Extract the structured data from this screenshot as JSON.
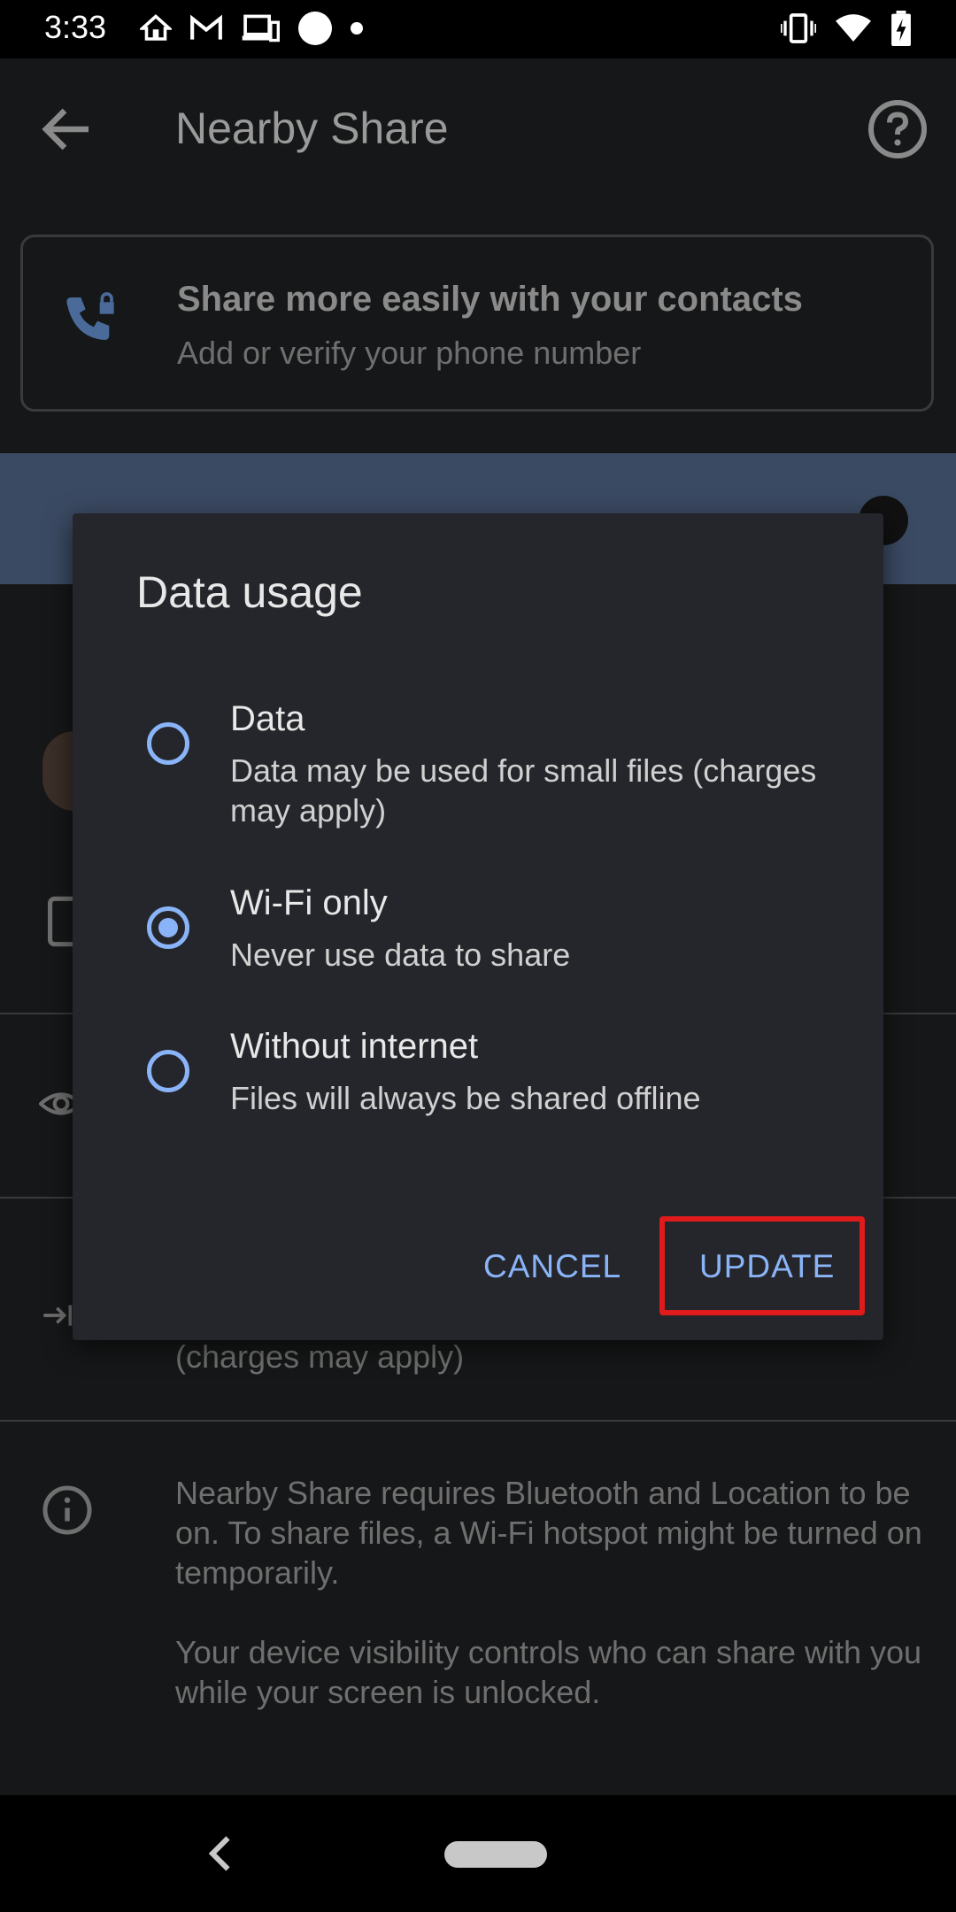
{
  "status_bar": {
    "time": "3:33"
  },
  "app_bar": {
    "title": "Nearby Share",
    "back_icon": "arrow-back-icon",
    "help_icon": "help-circle-icon"
  },
  "contacts_card": {
    "title": "Share more easily with your contacts",
    "subtitle": "Add or verify your phone number",
    "icon": "phone-lock-icon"
  },
  "background": {
    "charges_text": "(charges may apply)",
    "info_paragraphs": [
      "Nearby Share requires Bluetooth and Location to be on. To share files, a Wi-Fi hotspot might be turned on temporarily.",
      "Your device visibility controls who can share with you while your screen is unlocked."
    ]
  },
  "dialog": {
    "title": "Data usage",
    "options": [
      {
        "label": "Data",
        "description": "Data may be used for small files (charges may apply)",
        "selected": false
      },
      {
        "label": "Wi-Fi only",
        "description": "Never use data to share",
        "selected": true
      },
      {
        "label": "Without internet",
        "description": "Files will always be shared offline",
        "selected": false
      }
    ],
    "cancel_label": "CANCEL",
    "update_label": "UPDATE"
  },
  "colors": {
    "accent": "#8ab4f8",
    "dialog_bg": "#25262b",
    "highlight": "#e01b1b"
  }
}
